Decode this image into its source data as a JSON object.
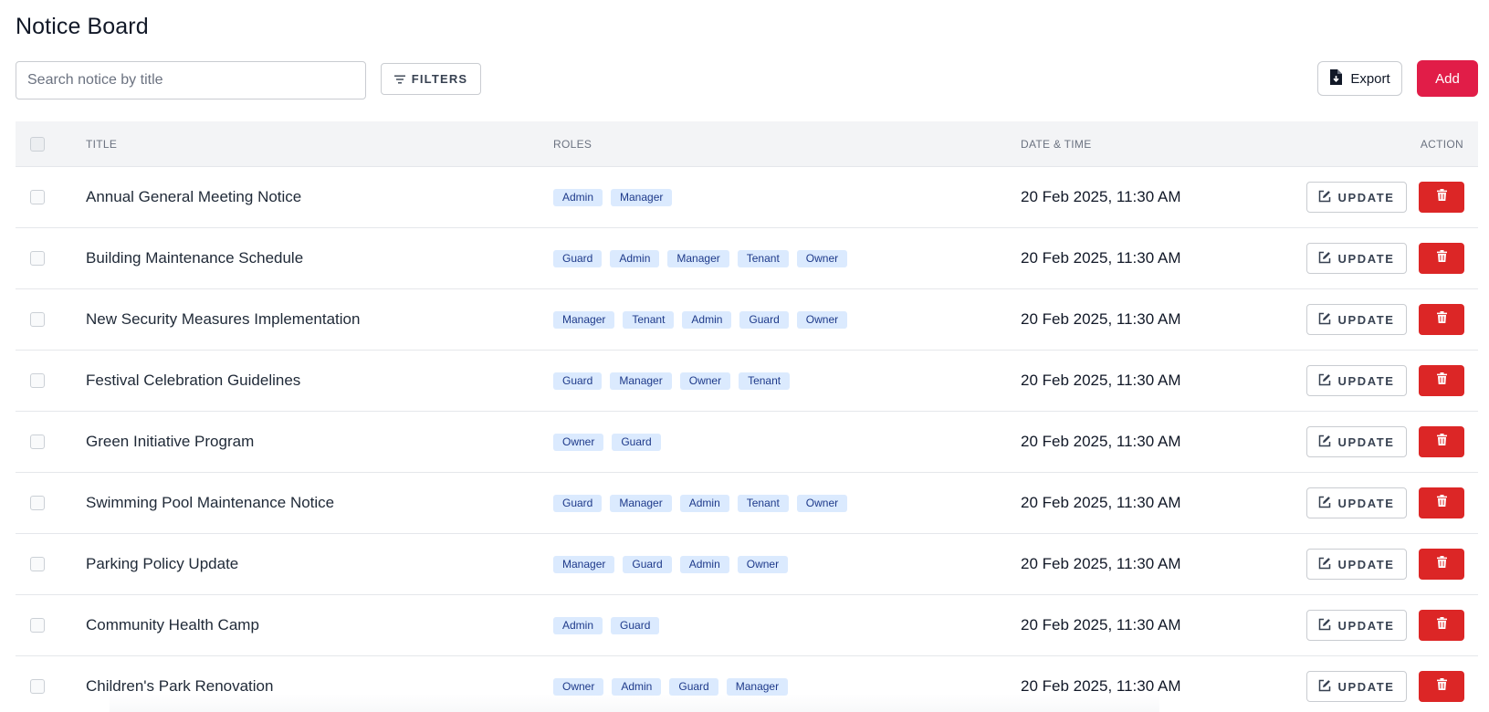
{
  "header": {
    "title": "Notice Board"
  },
  "toolbar": {
    "search_placeholder": "Search notice by title",
    "search_value": "",
    "filters_label": "FILTERS",
    "export_label": "Export",
    "add_label": "Add"
  },
  "table": {
    "columns": {
      "title": "TITLE",
      "roles": "ROLES",
      "datetime": "DATE & TIME",
      "action": "ACTION"
    },
    "update_label": "UPDATE",
    "rows": [
      {
        "title": "Annual General Meeting Notice",
        "roles": [
          "Admin",
          "Manager"
        ],
        "datetime": "20 Feb 2025, 11:30 AM"
      },
      {
        "title": "Building Maintenance Schedule",
        "roles": [
          "Guard",
          "Admin",
          "Manager",
          "Tenant",
          "Owner"
        ],
        "datetime": "20 Feb 2025, 11:30 AM"
      },
      {
        "title": "New Security Measures Implementation",
        "roles": [
          "Manager",
          "Tenant",
          "Admin",
          "Guard",
          "Owner"
        ],
        "datetime": "20 Feb 2025, 11:30 AM"
      },
      {
        "title": "Festival Celebration Guidelines",
        "roles": [
          "Guard",
          "Manager",
          "Owner",
          "Tenant"
        ],
        "datetime": "20 Feb 2025, 11:30 AM"
      },
      {
        "title": "Green Initiative Program",
        "roles": [
          "Owner",
          "Guard"
        ],
        "datetime": "20 Feb 2025, 11:30 AM"
      },
      {
        "title": "Swimming Pool Maintenance Notice",
        "roles": [
          "Guard",
          "Manager",
          "Admin",
          "Tenant",
          "Owner"
        ],
        "datetime": "20 Feb 2025, 11:30 AM"
      },
      {
        "title": "Parking Policy Update",
        "roles": [
          "Manager",
          "Guard",
          "Admin",
          "Owner"
        ],
        "datetime": "20 Feb 2025, 11:30 AM"
      },
      {
        "title": "Community Health Camp",
        "roles": [
          "Admin",
          "Guard"
        ],
        "datetime": "20 Feb 2025, 11:30 AM"
      },
      {
        "title": "Children's Park Renovation",
        "roles": [
          "Owner",
          "Admin",
          "Guard",
          "Manager"
        ],
        "datetime": "20 Feb 2025, 11:30 AM"
      }
    ]
  },
  "icons": {
    "filters": "filter-lines-icon",
    "export": "file-export-icon",
    "update": "edit-icon",
    "delete": "trash-icon"
  },
  "colors": {
    "add_button": "#e11d48",
    "delete_button": "#dc2626",
    "role_badge_bg": "#dbeafe",
    "role_badge_text": "#1e3a8a",
    "header_bg": "#f3f4f6"
  }
}
